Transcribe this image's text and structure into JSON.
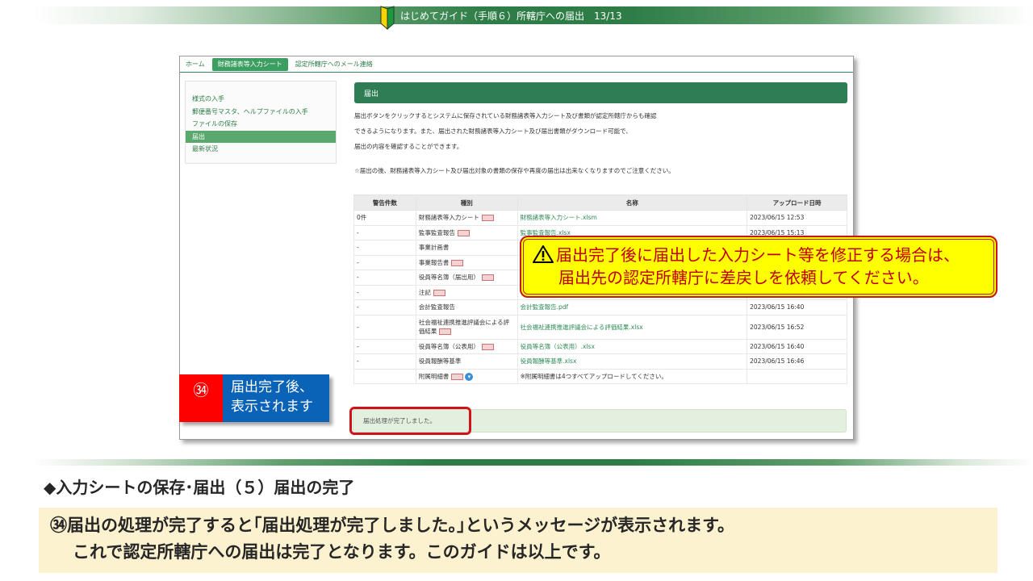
{
  "header": {
    "title": "はじめてガイド（手順６）所轄庁への届出　13/13",
    "beginner_icon": "beginner-mark-icon"
  },
  "screenshot": {
    "nav": {
      "home": "ホーム",
      "sheet": "財務諸表等入力シート",
      "mail": "認定所轄庁へのメール連絡"
    },
    "sidebar": [
      "様式の入手",
      "郵便番号マスタ、ヘルプファイルの入手",
      "ファイルの保存",
      "届出",
      "最新状況"
    ],
    "panel_title": "届出",
    "description": [
      "届出ボタンをクリックするとシステムに保存されている財務諸表等入力シート及び書類が認定所轄庁からも確認",
      "できるようになります。また、届出された財務諸表等入力シート及び届出書類がダウンロード可能で、",
      "届出の内容を確認することができます。"
    ],
    "note": "☆届出の後、財務諸表等入力シート及び届出対象の書類の保存や再度の届出は出来なくなりますのでご注意ください。",
    "table": {
      "headers": [
        "警告件数",
        "種別",
        "名称",
        "アップロード日時"
      ],
      "rows": [
        {
          "count": "0件",
          "type": "財務諸表等入力シート",
          "req": true,
          "name": "財務諸表等入力シート.xlsm",
          "date": "2023/06/15 12:53"
        },
        {
          "count": "-",
          "type": "監事監査報告",
          "req": true,
          "name": "監事監査報告.xlsx",
          "date": "2023/06/15 15:13"
        },
        {
          "count": "-",
          "type": "事業計画書",
          "req": false,
          "name": "",
          "date": ""
        },
        {
          "count": "-",
          "type": "事業報告書",
          "req": true,
          "name": "",
          "date": ""
        },
        {
          "count": "-",
          "type": "役員等名簿（届出用）",
          "req": true,
          "name": "",
          "date": ""
        },
        {
          "count": "-",
          "type": "注記",
          "req": true,
          "name": "",
          "date": ""
        },
        {
          "count": "-",
          "type": "会計監査報告",
          "req": false,
          "name": "会計監査報告.pdf",
          "date": "2023/06/15 16:40"
        },
        {
          "count": "-",
          "type": "社会福祉連携推進評議会による評価結果",
          "req": true,
          "name": "社会福祉連携推進評議会による評価結果.xlsx",
          "date": "2023/06/15 16:52",
          "tall": true
        },
        {
          "count": "-",
          "type": "役員等名簿（公表用）",
          "req": true,
          "name": "役員等名簿（公表用）.xlsx",
          "date": "2023/06/15 16:40"
        },
        {
          "count": "-",
          "type": "役員報酬等基準",
          "req": false,
          "name": "役員報酬等基準.xlsx",
          "date": "2023/06/15 16:46"
        },
        {
          "count": "",
          "type": "附属明細書",
          "req": true,
          "info": true,
          "name": "※附属明細書は4つすべてアップロードしてください。",
          "date": "",
          "plain": true
        }
      ]
    },
    "done_message": "届出処理が完了しました。"
  },
  "callout": {
    "line1": "届出完了後に届出した入力シート等を修正する場合は、",
    "line2": "届出先の認定所轄庁に差戻しを依頼してください。",
    "icon": "warning-icon",
    "color": "#c00000"
  },
  "step": {
    "number": "㉞",
    "line1": "届出完了後、",
    "line2": "表示されます"
  },
  "section_title": "◆入力シートの保存･届出（５）届出の完了",
  "explanation": {
    "line1": "㉞届出の処理が完了すると｢届出処理が完了しました。｣というメッセージが表示されます。",
    "line2": "これで認定所轄庁への届出は完了となります。このガイドは以上です。"
  }
}
